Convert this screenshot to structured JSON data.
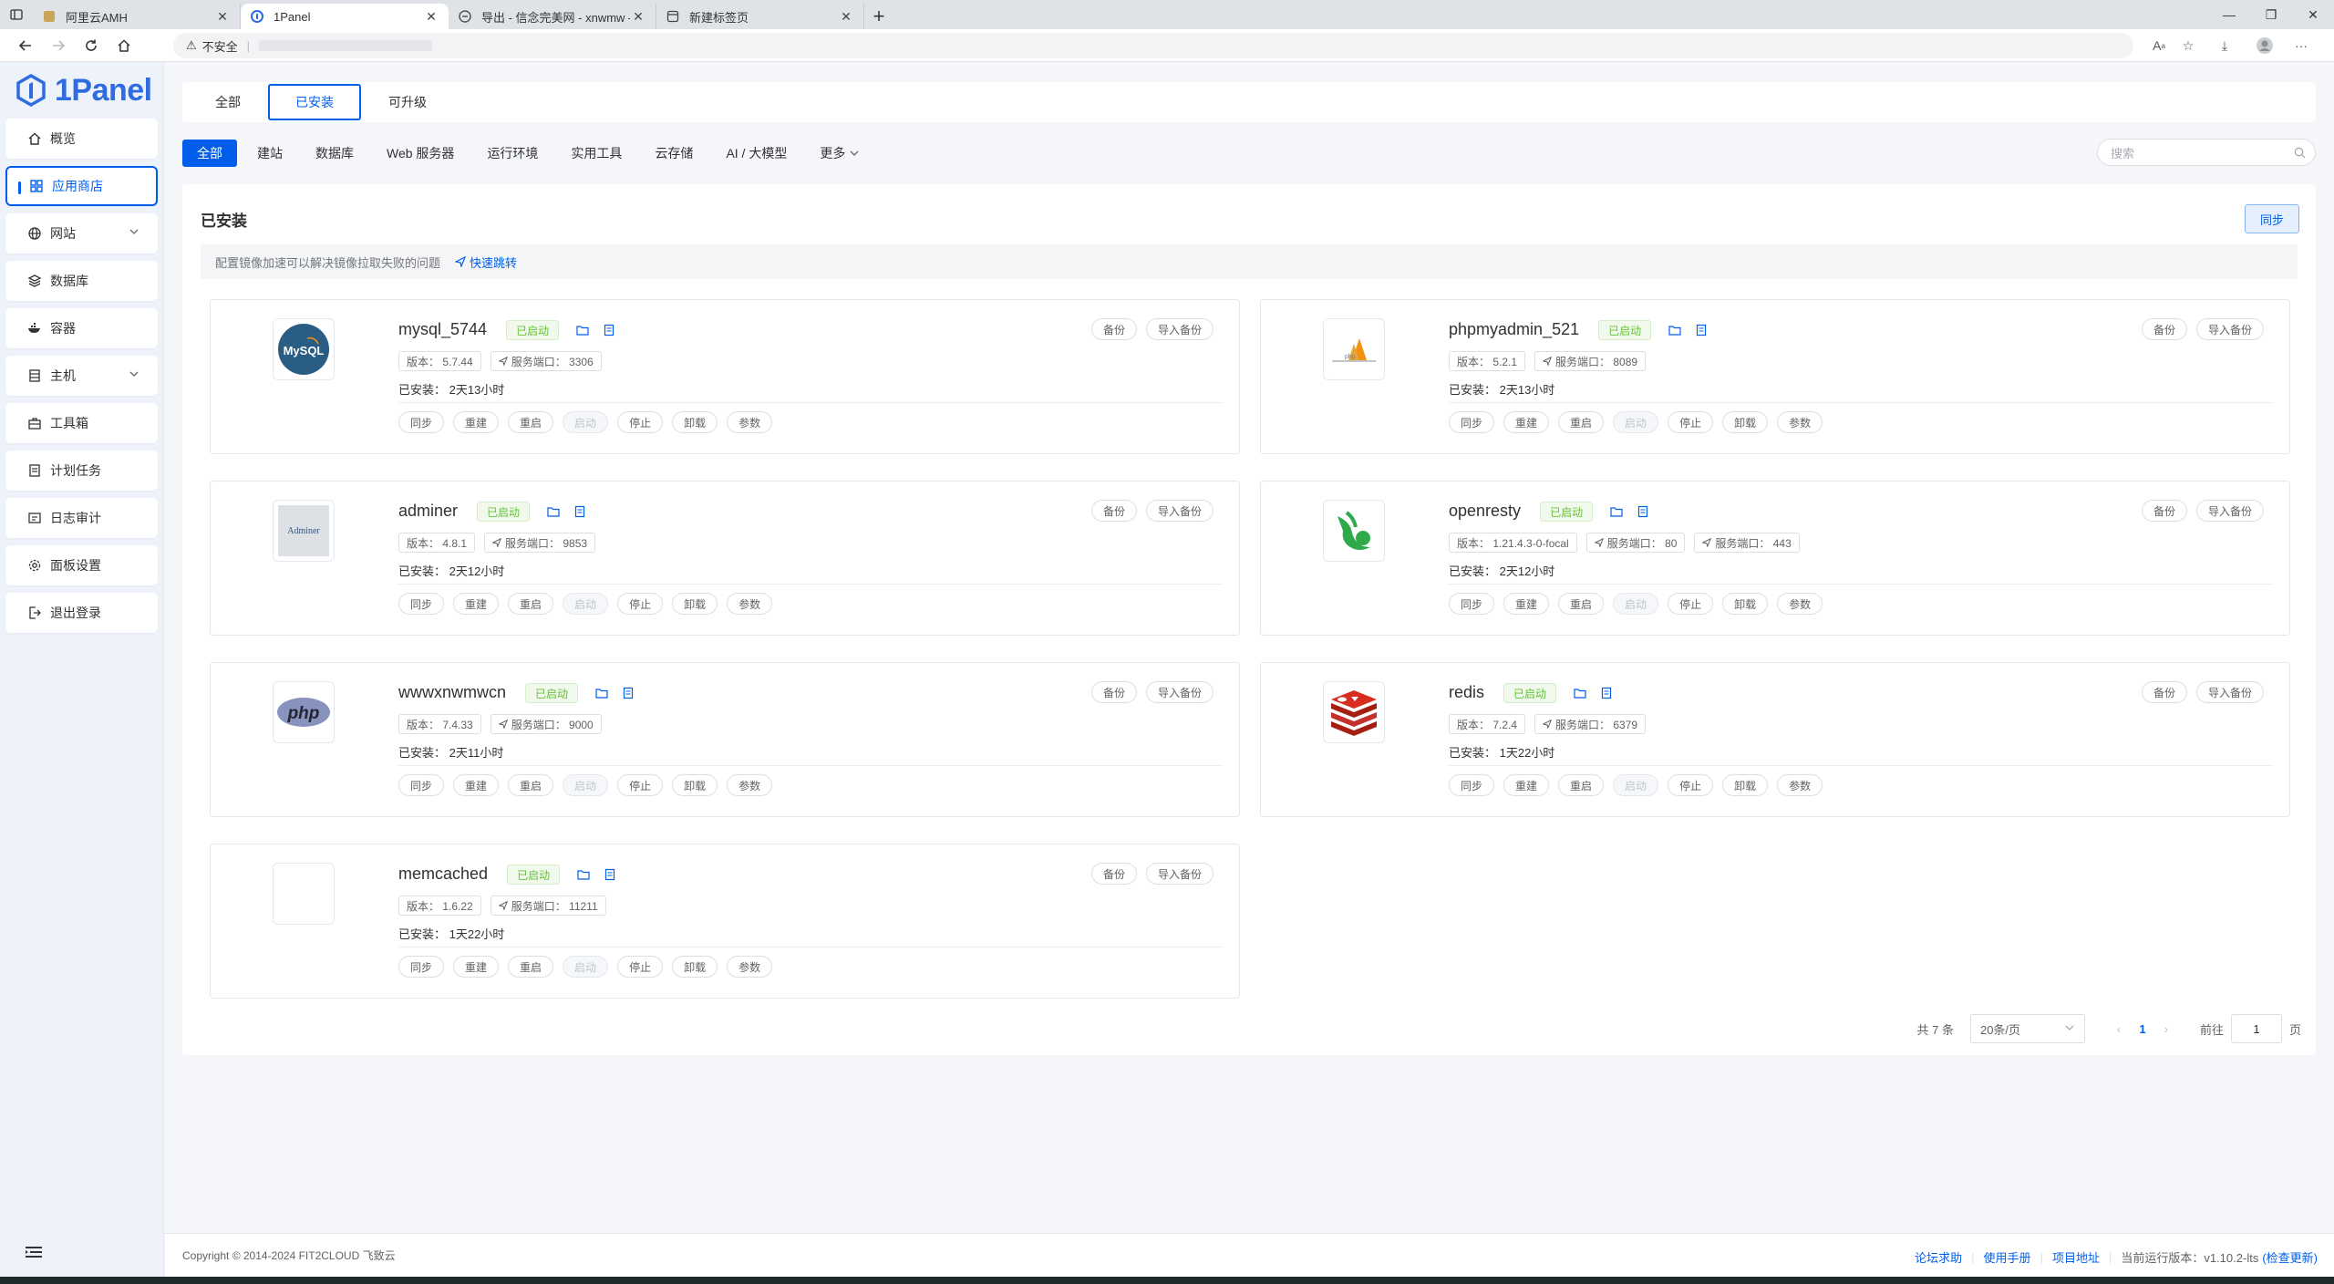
{
  "browser": {
    "tabs": [
      {
        "title": "阿里云AMH"
      },
      {
        "title": "1Panel"
      },
      {
        "title": "导出 - 信念完美网 - xnwmw — "
      },
      {
        "title": "新建标签页"
      }
    ],
    "security_label": "不安全"
  },
  "sidebar": {
    "logo_text": "1Panel",
    "items": [
      {
        "label": "概览",
        "icon": "home-icon"
      },
      {
        "label": "应用商店",
        "icon": "grid-icon",
        "active": true
      },
      {
        "label": "网站",
        "icon": "globe-icon",
        "expandable": true
      },
      {
        "label": "数据库",
        "icon": "layers-icon"
      },
      {
        "label": "容器",
        "icon": "docker-icon"
      },
      {
        "label": "主机",
        "icon": "server-icon",
        "expandable": true
      },
      {
        "label": "工具箱",
        "icon": "toolbox-icon"
      },
      {
        "label": "计划任务",
        "icon": "list-icon"
      },
      {
        "label": "日志审计",
        "icon": "log-icon"
      },
      {
        "label": "面板设置",
        "icon": "gear-icon"
      },
      {
        "label": "退出登录",
        "icon": "logout-icon"
      }
    ]
  },
  "topnav": {
    "tabs": [
      "全部",
      "已安装",
      "可升级"
    ],
    "active": "已安装"
  },
  "categories": {
    "items": [
      "全部",
      "建站",
      "数据库",
      "Web 服务器",
      "运行环境",
      "实用工具",
      "云存储",
      "AI / 大模型",
      "更多"
    ],
    "active": "全部",
    "search_placeholder": "搜索"
  },
  "panel": {
    "title": "已安装",
    "sync_label": "同步",
    "notice": "配置镜像加速可以解决镜像拉取失败的问题",
    "notice_link": "快速跳转"
  },
  "card_labels": {
    "status": "已启动",
    "backup": "备份",
    "import_backup": "导入备份",
    "actions": [
      "同步",
      "重建",
      "重启",
      "启动",
      "停止",
      "卸载",
      "参数"
    ],
    "disabled_action": "启动"
  },
  "apps": [
    {
      "name": "mysql_5744",
      "version": "版本： 5.7.44",
      "ports": [
        "服务端口： 3306"
      ],
      "installed": "已安装： 2天13小时",
      "logo": "mysql-logo"
    },
    {
      "name": "phpmyadmin_521",
      "version": "版本： 5.2.1",
      "ports": [
        "服务端口： 8089"
      ],
      "installed": "已安装： 2天13小时",
      "logo": "phpmyadmin-logo"
    },
    {
      "name": "adminer",
      "version": "版本： 4.8.1",
      "ports": [
        "服务端口： 9853"
      ],
      "installed": "已安装： 2天12小时",
      "logo": "adminer-logo"
    },
    {
      "name": "openresty",
      "version": "版本： 1.21.4.3-0-focal",
      "ports": [
        "服务端口： 80",
        "服务端口： 443"
      ],
      "installed": "已安装： 2天12小时",
      "logo": "openresty-logo"
    },
    {
      "name": "wwwxnwmwcn",
      "version": "版本： 7.4.33",
      "ports": [
        "服务端口： 9000"
      ],
      "installed": "已安装： 2天11小时",
      "logo": "php-logo"
    },
    {
      "name": "redis",
      "version": "版本： 7.2.4",
      "ports": [
        "服务端口： 6379"
      ],
      "installed": "已安装： 1天22小时",
      "logo": "redis-logo"
    },
    {
      "name": "memcached",
      "version": "版本： 1.6.22",
      "ports": [
        "服务端口： 11211"
      ],
      "installed": "已安装： 1天22小时",
      "logo": "memcached-logo"
    }
  ],
  "pagination": {
    "total": "共 7 条",
    "page_size": "20条/页",
    "current": "1",
    "goto_label": "前往",
    "goto_value": "1",
    "page_suffix": "页"
  },
  "footer": {
    "copyright": "Copyright © 2014-2024 FIT2CLOUD 飞致云",
    "links": [
      "论坛求助",
      "使用手册",
      "项目地址"
    ],
    "version_label": "当前运行版本：v1.10.2-lts",
    "check_update": "(检查更新)"
  },
  "colors": {
    "accent": "#005eeb",
    "success": "#67c23a",
    "sidebar_bg": "#eef3fb"
  }
}
